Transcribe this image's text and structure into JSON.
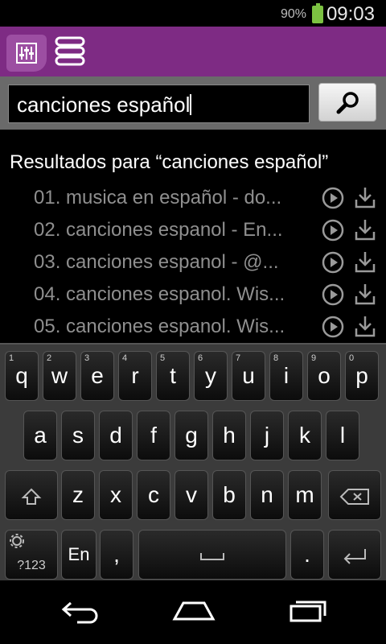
{
  "status_bar": {
    "battery_percent": "90%",
    "time": "09:03",
    "battery_color": "#7cc242"
  },
  "app_bar": {
    "color": "#7e2b84",
    "equalizer_icon": "equalizer-icon",
    "menu_icon": "stacked-menu-icon"
  },
  "search": {
    "value": "canciones español",
    "button_icon": "search-icon"
  },
  "results": {
    "title": "Resultados para “canciones español”",
    "items": [
      {
        "label": "01. musica en español - do..."
      },
      {
        "label": "02. canciones espanol - En..."
      },
      {
        "label": "03. canciones espanol - @..."
      },
      {
        "label": "04. canciones espanol. Wis..."
      },
      {
        "label": "05. canciones espanol. Wis..."
      }
    ]
  },
  "keyboard": {
    "row1": [
      {
        "k": "q",
        "n": "1"
      },
      {
        "k": "w",
        "n": "2"
      },
      {
        "k": "e",
        "n": "3"
      },
      {
        "k": "r",
        "n": "4"
      },
      {
        "k": "t",
        "n": "5"
      },
      {
        "k": "y",
        "n": "6"
      },
      {
        "k": "u",
        "n": "7"
      },
      {
        "k": "i",
        "n": "8"
      },
      {
        "k": "o",
        "n": "9"
      },
      {
        "k": "p",
        "n": "0"
      }
    ],
    "row2": [
      "a",
      "s",
      "d",
      "f",
      "g",
      "h",
      "j",
      "k",
      "l"
    ],
    "row3": [
      "z",
      "x",
      "c",
      "v",
      "b",
      "n",
      "m"
    ],
    "symbols_label": "?123",
    "language_label": "En",
    "comma_label": ",",
    "period_label": "."
  },
  "nav_bar": {
    "back_icon": "back-icon",
    "home_icon": "home-icon",
    "recents_icon": "recents-icon"
  }
}
